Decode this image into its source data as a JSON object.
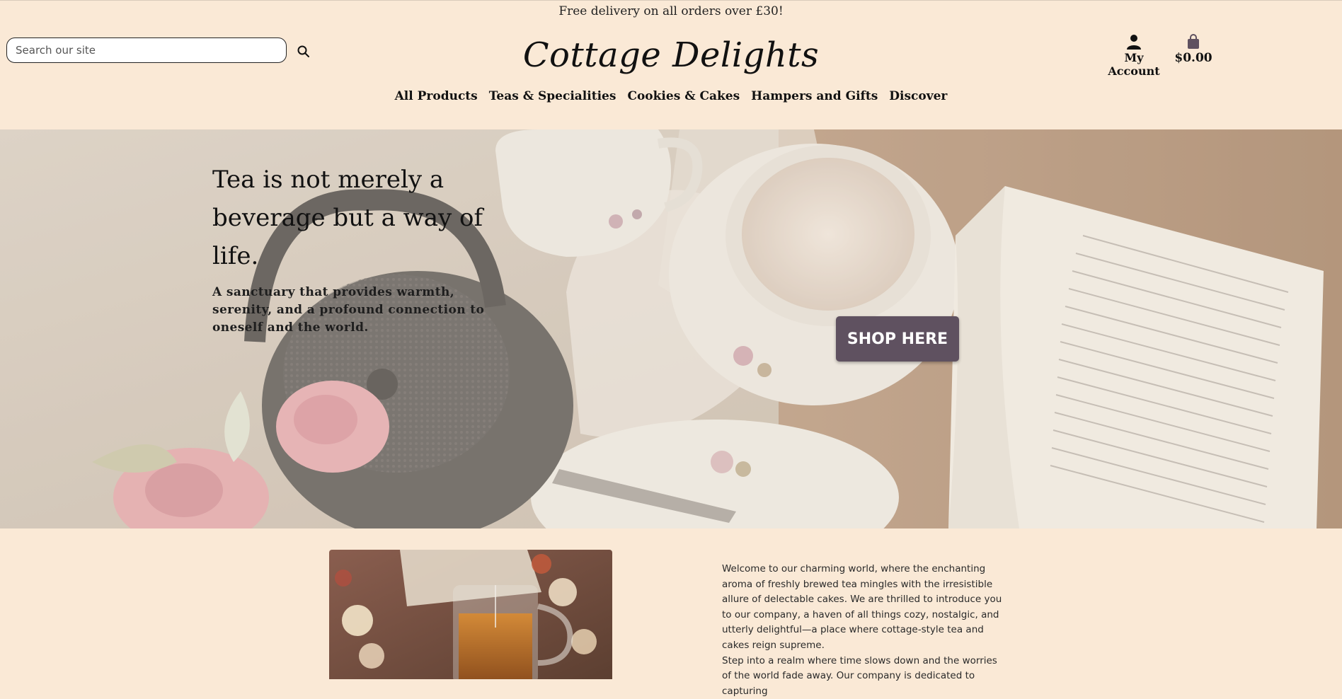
{
  "promo": {
    "text": "Free delivery on all orders over £30!"
  },
  "header": {
    "search_placeholder": "Search our site",
    "search_icon": "search-icon",
    "logo": "Cottage Delights",
    "account_label": "My Account",
    "account_icon": "user-icon",
    "cart_total": "$0.00",
    "cart_icon": "shopping-bag-icon"
  },
  "nav": {
    "items": [
      "All Products",
      "Teas & Specialities",
      "Cookies & Cakes",
      "Hampers and Gifts",
      "Discover"
    ]
  },
  "hero": {
    "title": "Tea is not merely a beverage but a way of life.",
    "subtitle": "A sanctuary that provides warmth, serenity, and a profound connection to oneself and the world.",
    "cta": "SHOP HERE"
  },
  "welcome": {
    "para1": "Welcome to our charming world, where the enchanting aroma of freshly brewed tea mingles with the irresistible allure of delectable cakes. We are thrilled to introduce you to our company, a haven of all things cozy, nostalgic, and utterly delightful—a place where cottage-style tea and cakes reign supreme.",
    "para2": "Step into a realm where time slows down and the worries of the world fade away. Our company is dedicated to capturing"
  },
  "colors": {
    "page_bg": "#fae9d6",
    "cta_bg": "#5f5160",
    "cart_icon": "#5f5160"
  }
}
